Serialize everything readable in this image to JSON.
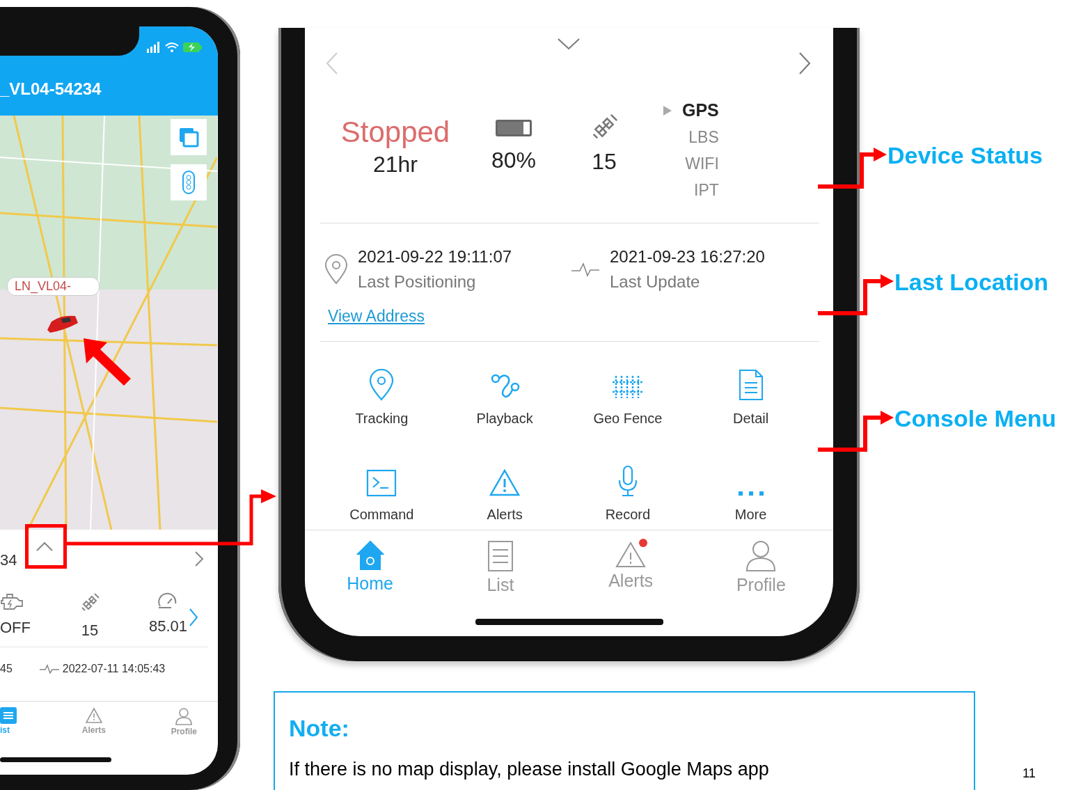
{
  "left_phone": {
    "header_title": "_VL04-54234",
    "marker_label": "LN_VL04-",
    "device_id_fragment": "34",
    "stats": [
      {
        "kind": "engine",
        "value": "OFF"
      },
      {
        "kind": "satellites",
        "value": "15"
      },
      {
        "kind": "speed",
        "value": "85.01"
      }
    ],
    "time_fragment": "45",
    "last_update": "2022-07-11 14:05:43",
    "tabs": [
      {
        "kind": "list",
        "label": "ist",
        "selected": true
      },
      {
        "kind": "alerts",
        "label": "Alerts",
        "selected": false
      },
      {
        "kind": "profile",
        "label": "Profile",
        "selected": false
      }
    ]
  },
  "right_phone": {
    "status": "Stopped",
    "duration": "21hr",
    "battery": {
      "reading": "80%",
      "level": 0.8
    },
    "satellites": "15",
    "sources": [
      {
        "label": "GPS",
        "selected": true
      },
      {
        "label": "LBS",
        "selected": false
      },
      {
        "label": "WIFI",
        "selected": false
      },
      {
        "label": "IPT",
        "selected": false
      }
    ],
    "last_positioning": {
      "time": "2021-09-22 19:11:07",
      "label": "Last Positioning"
    },
    "last_update": {
      "time": "2021-09-23 16:27:20",
      "label": "Last Update"
    },
    "view_address": "View Address",
    "menu": [
      {
        "kind": "tracking",
        "label": "Tracking"
      },
      {
        "kind": "playback",
        "label": "Playback"
      },
      {
        "kind": "geofence",
        "label": "Geo Fence"
      },
      {
        "kind": "detail",
        "label": "Detail"
      },
      {
        "kind": "command",
        "label": "Command"
      },
      {
        "kind": "alerts",
        "label": "Alerts"
      },
      {
        "kind": "record",
        "label": "Record"
      },
      {
        "kind": "more",
        "label": "More"
      }
    ],
    "tabs": [
      {
        "kind": "home",
        "label": "Home",
        "selected": true,
        "badge": false
      },
      {
        "kind": "list",
        "label": "List",
        "selected": false,
        "badge": false
      },
      {
        "kind": "alerts",
        "label": "Alerts",
        "selected": false,
        "badge": true
      },
      {
        "kind": "profile",
        "label": "Profile",
        "selected": false,
        "badge": false
      }
    ]
  },
  "annotations": [
    {
      "label": "Device Status"
    },
    {
      "label": "Last Location"
    },
    {
      "label": "Console Menu"
    }
  ],
  "note": {
    "title": "Note:",
    "text": "If there is no map display, please install Google Maps app"
  },
  "page_number": "11"
}
